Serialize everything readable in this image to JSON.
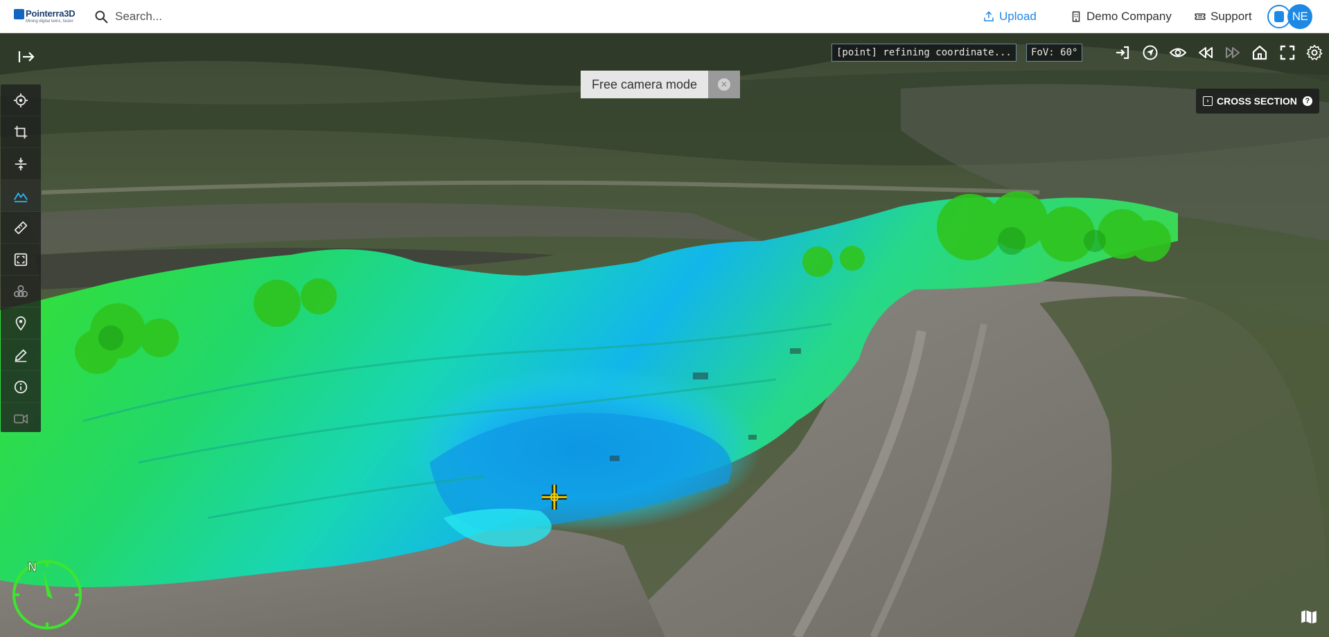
{
  "header": {
    "logo": {
      "name": "Pointerra3D",
      "tagline": "Mining digital twins, faster"
    },
    "search": {
      "placeholder": "Search..."
    },
    "upload_label": "Upload",
    "company_label": "Demo Company",
    "support_label": "Support",
    "user_initials": "NE"
  },
  "viewer": {
    "camera_mode_label": "Free camera mode",
    "status_text": "[point] refining coordinate...",
    "fov_text": "FoV: 60°",
    "cross_section_label": "CROSS SECTION",
    "cross_section_help": "?",
    "compass_north": "N"
  },
  "toolbar": {
    "tools": [
      {
        "icon": "target-icon",
        "active": false
      },
      {
        "icon": "crop-icon",
        "active": false
      },
      {
        "icon": "vertical-split-icon",
        "active": false
      },
      {
        "icon": "terrain-icon",
        "active": true
      },
      {
        "icon": "ruler-icon",
        "active": false
      },
      {
        "icon": "area-frame-icon",
        "active": false
      },
      {
        "icon": "layers-cluster-icon",
        "active": false
      },
      {
        "icon": "map-pin-icon",
        "active": false
      },
      {
        "icon": "pen-icon",
        "active": false
      },
      {
        "icon": "info-icon",
        "active": false
      },
      {
        "icon": "video-camera-icon",
        "active": false
      }
    ]
  },
  "view_controls": [
    "login-icon",
    "navigate-icon",
    "eye-icon",
    "rewind-icon",
    "forward-icon",
    "home-icon",
    "fullscreen-icon",
    "settings-icon"
  ],
  "colors": {
    "accent": "#1e88e5",
    "toolbar_bg": "#1e211e",
    "active_tool": "#29b6f6",
    "cursor": "#f5d000"
  }
}
